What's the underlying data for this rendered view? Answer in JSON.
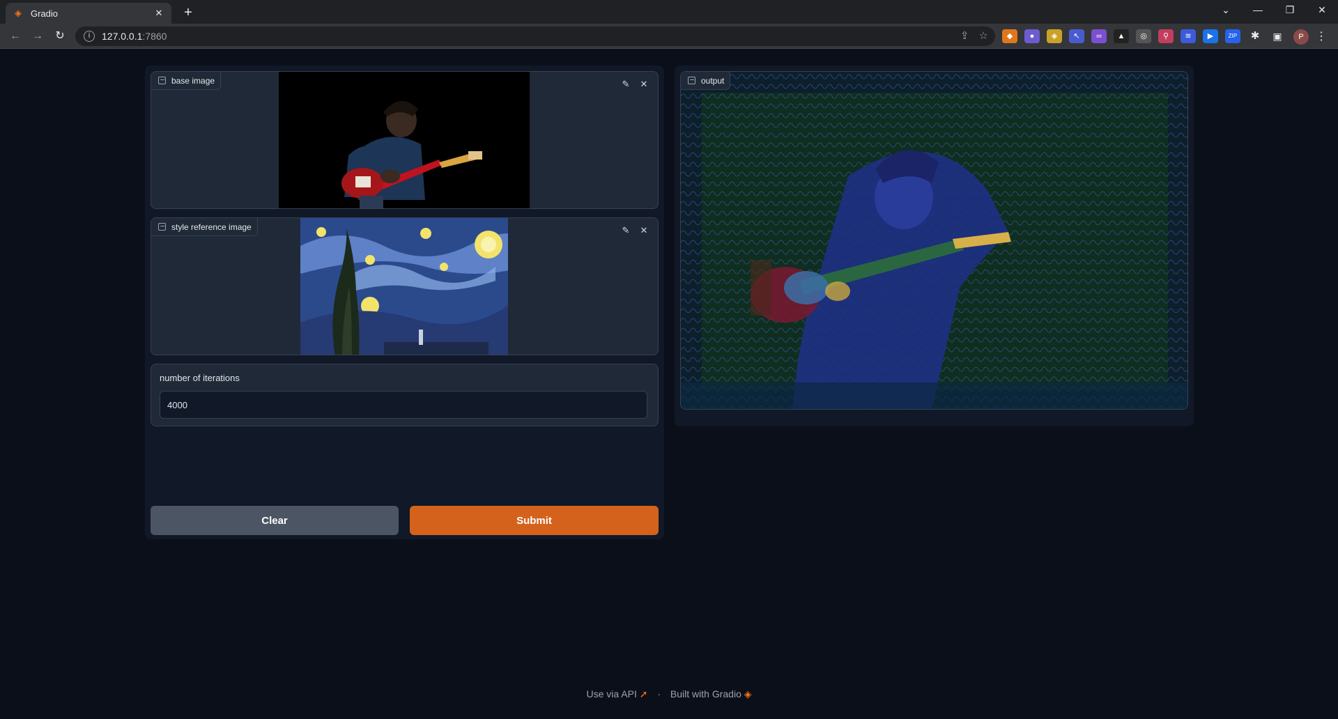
{
  "browser": {
    "tab_title": "Gradio",
    "url_host": "127.0.0.1",
    "url_port": ":7860",
    "profile_initial": "P"
  },
  "inputs": {
    "base_image": {
      "label": "base image"
    },
    "style_image": {
      "label": "style reference image"
    },
    "iterations": {
      "label": "number of iterations",
      "value": "4000"
    }
  },
  "buttons": {
    "clear": "Clear",
    "submit": "Submit"
  },
  "output": {
    "label": "output"
  },
  "footer": {
    "api_text": "Use via API",
    "separator": "·",
    "built_with": "Built with Gradio"
  },
  "colors": {
    "accent": "#d4621d",
    "background": "#0b0f19",
    "panel": "#1f2937"
  }
}
